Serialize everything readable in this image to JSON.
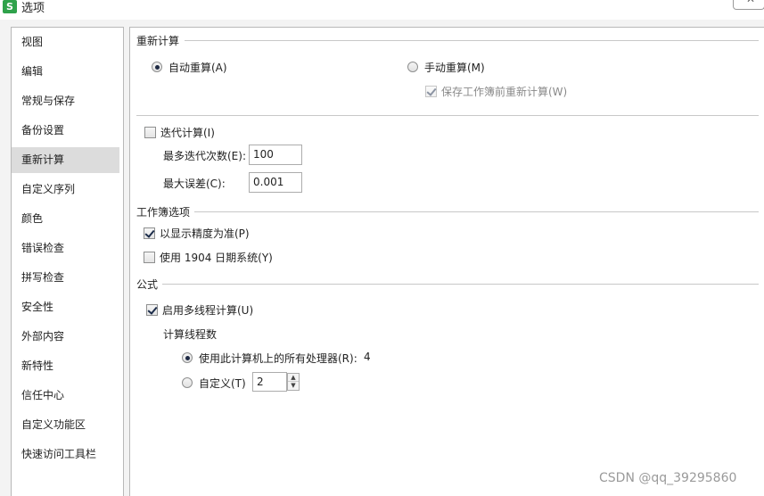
{
  "window": {
    "title": "选项",
    "app_icon_letter": "S",
    "close_glyph": "✕"
  },
  "sidebar": {
    "items": [
      {
        "label": "视图"
      },
      {
        "label": "编辑"
      },
      {
        "label": "常规与保存"
      },
      {
        "label": "备份设置"
      },
      {
        "label": "重新计算",
        "active": true
      },
      {
        "label": "自定义序列"
      },
      {
        "label": "颜色"
      },
      {
        "label": "错误检查"
      },
      {
        "label": "拼写检查"
      },
      {
        "label": "安全性"
      },
      {
        "label": "外部内容"
      },
      {
        "label": "新特性"
      },
      {
        "label": "信任中心"
      },
      {
        "label": "自定义功能区"
      },
      {
        "label": "快速访问工具栏"
      }
    ]
  },
  "recalc": {
    "section_title": "重新计算",
    "auto_label": "自动重算(A)",
    "manual_label": "手动重算(M)",
    "save_recalc_label": "保存工作簿前重新计算(W)",
    "iter_label": "迭代计算(I)",
    "max_iter_label": "最多迭代次数(E):",
    "max_iter_value": "100",
    "max_change_label": "最大误差(C):",
    "max_change_value": "0.001"
  },
  "workbook": {
    "section_title": "工作簿选项",
    "precision_label": "以显示精度为准(P)",
    "date1904_label": "使用 1904 日期系统(Y)"
  },
  "formula": {
    "section_title": "公式",
    "multithread_label": "启用多线程计算(U)",
    "threads_title": "计算线程数",
    "use_all_label": "使用此计算机上的所有处理器(R):",
    "processor_count": "4",
    "custom_label": "自定义(T)",
    "custom_value": "2"
  },
  "watermark": "CSDN @qq_39295860"
}
